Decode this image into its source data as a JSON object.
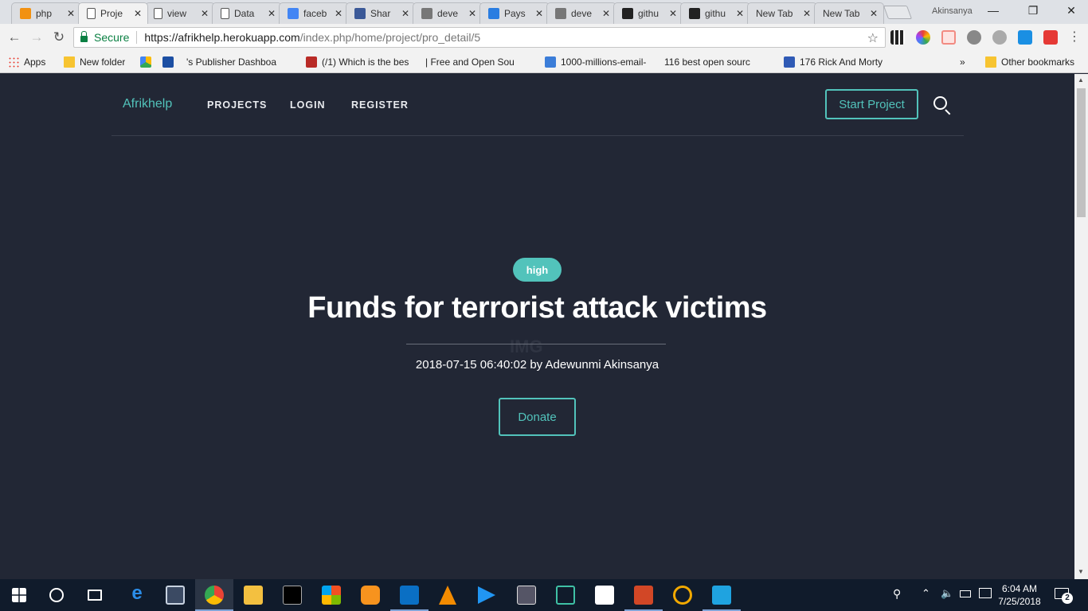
{
  "browser": {
    "tabs": [
      {
        "title": "php",
        "favicon": "pma-icon",
        "color": "#f29111"
      },
      {
        "title": "Proje",
        "favicon": "page-icon",
        "color": "#ffffff",
        "active": true
      },
      {
        "title": "view",
        "favicon": "page-icon",
        "color": "#ffffff"
      },
      {
        "title": "Data",
        "favicon": "page-icon",
        "color": "#ffffff"
      },
      {
        "title": "faceb",
        "favicon": "google-icon",
        "color": "#4285f4"
      },
      {
        "title": "Shar",
        "favicon": "facebook-icon",
        "color": "#3b5998"
      },
      {
        "title": "deve",
        "favicon": "doc-icon",
        "color": "#777777"
      },
      {
        "title": "Pays",
        "favicon": "doc-icon",
        "color": "#2a7de1"
      },
      {
        "title": "deve",
        "favicon": "doc-icon",
        "color": "#777777"
      },
      {
        "title": "githu",
        "favicon": "github-icon",
        "color": "#222222"
      },
      {
        "title": "githu",
        "favicon": "github-icon",
        "color": "#222222"
      },
      {
        "title": "New Tab",
        "favicon": "none",
        "color": "#dcdee2"
      },
      {
        "title": "New Tab",
        "favicon": "none",
        "color": "#dcdee2"
      }
    ],
    "profile_name": "Akinsanya",
    "secure_label": "Secure",
    "url_host": "https://afrikhelp.herokuapp.com",
    "url_path": "/index.php/home/project/pro_detail/5",
    "bookmarks": [
      {
        "label": "Apps",
        "icon": "apps-icon"
      },
      {
        "label": "New folder",
        "icon": "folder-icon"
      },
      {
        "label": "",
        "icon": "drive-icon"
      },
      {
        "label": "",
        "icon": "s-icon"
      },
      {
        "label": "'s Publisher Dashboa",
        "icon": "page-icon"
      },
      {
        "label": "(/1) Which is the bes",
        "icon": "quora-icon"
      },
      {
        "label": "| Free and Open Sou",
        "icon": "page-icon"
      },
      {
        "label": "1000-millions-email-",
        "icon": "infinity-icon"
      },
      {
        "label": "116 best open sourc",
        "icon": "page-icon"
      },
      {
        "label": "176 Rick And Morty",
        "icon": "w-icon"
      },
      {
        "label": "Other bookmarks",
        "icon": "folder-icon"
      }
    ],
    "overflow_label": "»"
  },
  "site": {
    "brand": "Afrikhelp",
    "nav": [
      "PROJECTS",
      "LOGIN",
      "REGISTER"
    ],
    "start_project": "Start Project",
    "accent_color": "#52c3bb",
    "background_color": "#222735"
  },
  "project": {
    "priority_badge": "high",
    "title": "Funds for terrorist attack victims",
    "ghost_text": "IMG",
    "meta": "2018-07-15 06:40:02 by Adewunmi Akinsanya",
    "donate_label": "Donate"
  },
  "taskbar": {
    "time": "6:04 AM",
    "date": "7/25/2018",
    "notification_count": "2"
  }
}
